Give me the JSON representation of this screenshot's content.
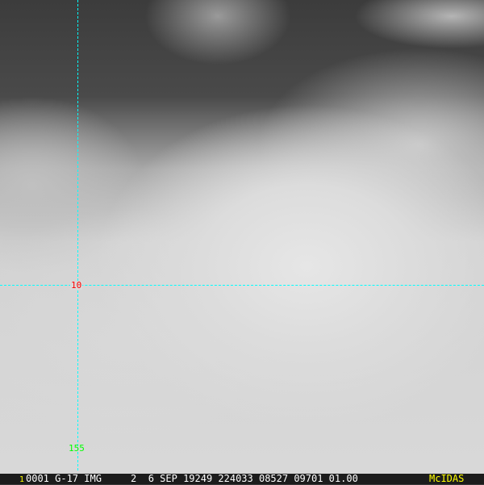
{
  "grid": {
    "lat_label": "10",
    "lon_label": "155",
    "grid_color": "#00ffff",
    "lat_label_color": "#ff0000",
    "lon_label_color": "#00ff00"
  },
  "status_bar": {
    "frame": "1",
    "info": "0001 G-17 IMG     2  6 SEP 19249 224033 08527 09701 01.00",
    "brand": "McIDAS",
    "brand_color": "#ffff00"
  }
}
